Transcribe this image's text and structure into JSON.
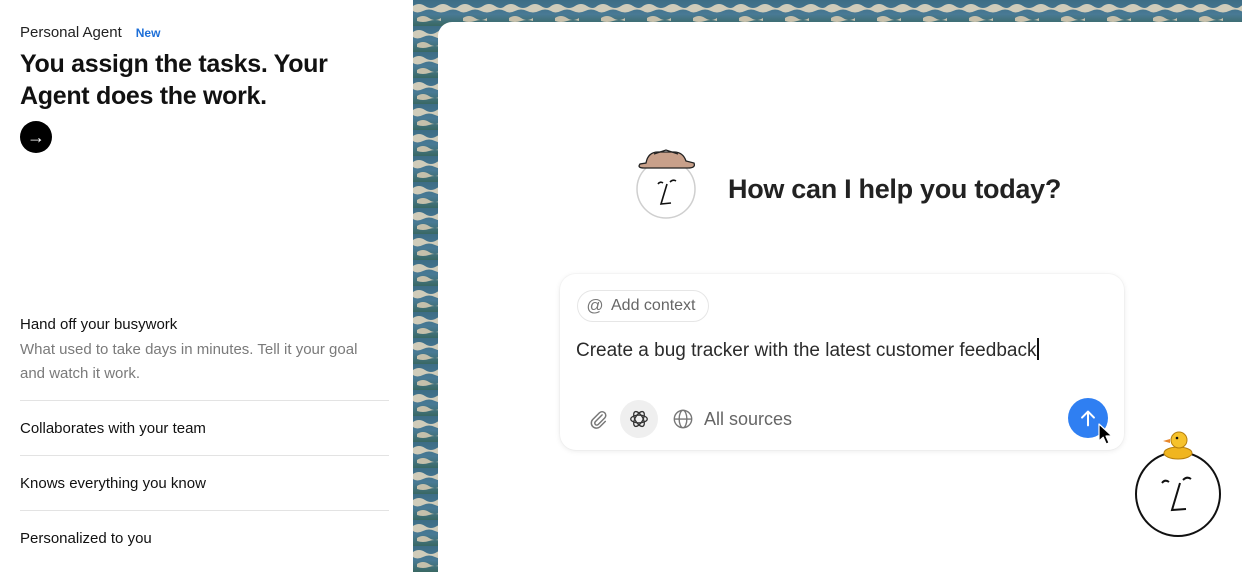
{
  "promo": {
    "eyebrow": "Personal Agent",
    "badge": "New",
    "headline": "You assign the tasks. Your Agent does the work.",
    "arrow": "→"
  },
  "features": {
    "main_title": "Hand off your busywork",
    "main_desc": "What used to take days in minutes. Tell it your goal and watch it work.",
    "items": [
      "Collaborates with your team",
      "Knows everything you know",
      "Personalized to you"
    ]
  },
  "chat": {
    "greeting": "How can I help you today?",
    "add_context": "Add context",
    "prompt": "Create a bug tracker with the latest customer feedback",
    "sources": "All sources"
  },
  "icons": {
    "arrow": "right-arrow-icon",
    "at": "at-sign-icon",
    "attach": "paperclip-icon",
    "model": "openai-icon",
    "globe": "globe-icon",
    "send": "arrow-up-icon"
  },
  "colors": {
    "accent": "#2f7ff2",
    "badge": "#1d6fd8"
  }
}
